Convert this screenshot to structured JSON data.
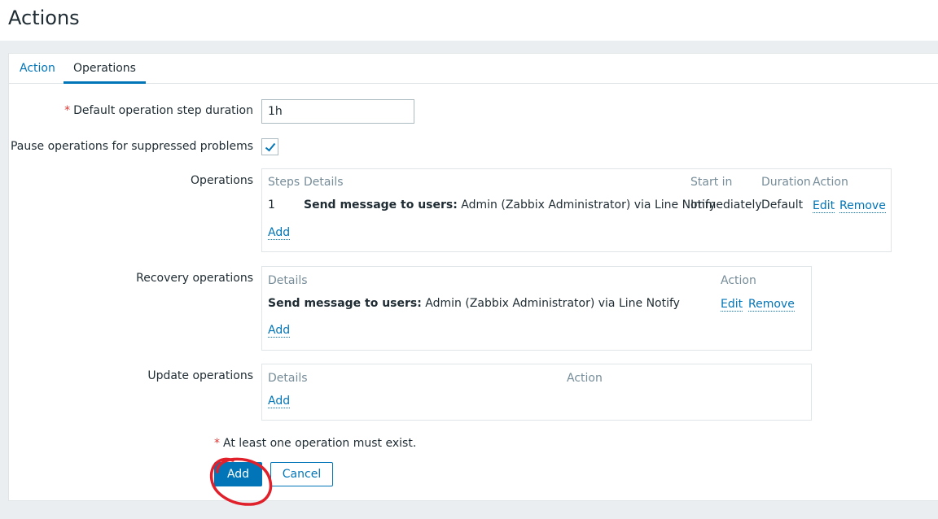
{
  "page_title": "Actions",
  "tabs": [
    {
      "label": "Action",
      "active": false
    },
    {
      "label": "Operations",
      "active": true
    }
  ],
  "form": {
    "step_duration_label": "Default operation step duration",
    "step_duration_value": "1h",
    "pause_label": "Pause operations for suppressed problems",
    "pause_checked": true,
    "required_marker": "*"
  },
  "operations": {
    "label": "Operations",
    "headers": [
      "Steps",
      "Details",
      "Start in",
      "Duration",
      "Action"
    ],
    "rows": [
      {
        "steps": "1",
        "details_bold": "Send message to users:",
        "details_text": " Admin (Zabbix Administrator) via Line Notify",
        "start_in": "Immediately",
        "duration": "Default",
        "edit": "Edit",
        "remove": "Remove"
      }
    ],
    "add_link": "Add"
  },
  "recovery": {
    "label": "Recovery operations",
    "headers": [
      "Details",
      "Action"
    ],
    "rows": [
      {
        "details_bold": "Send message to users:",
        "details_text": " Admin (Zabbix Administrator) via Line Notify",
        "edit": "Edit",
        "remove": "Remove"
      }
    ],
    "add_link": "Add"
  },
  "update": {
    "label": "Update operations",
    "headers": [
      "Details",
      "Action"
    ],
    "add_link": "Add"
  },
  "note": "At least one operation must exist.",
  "buttons": {
    "add": "Add",
    "cancel": "Cancel"
  },
  "colors": {
    "accent": "#0275b8",
    "required": "#e33734",
    "annotation": "#e0202a"
  }
}
